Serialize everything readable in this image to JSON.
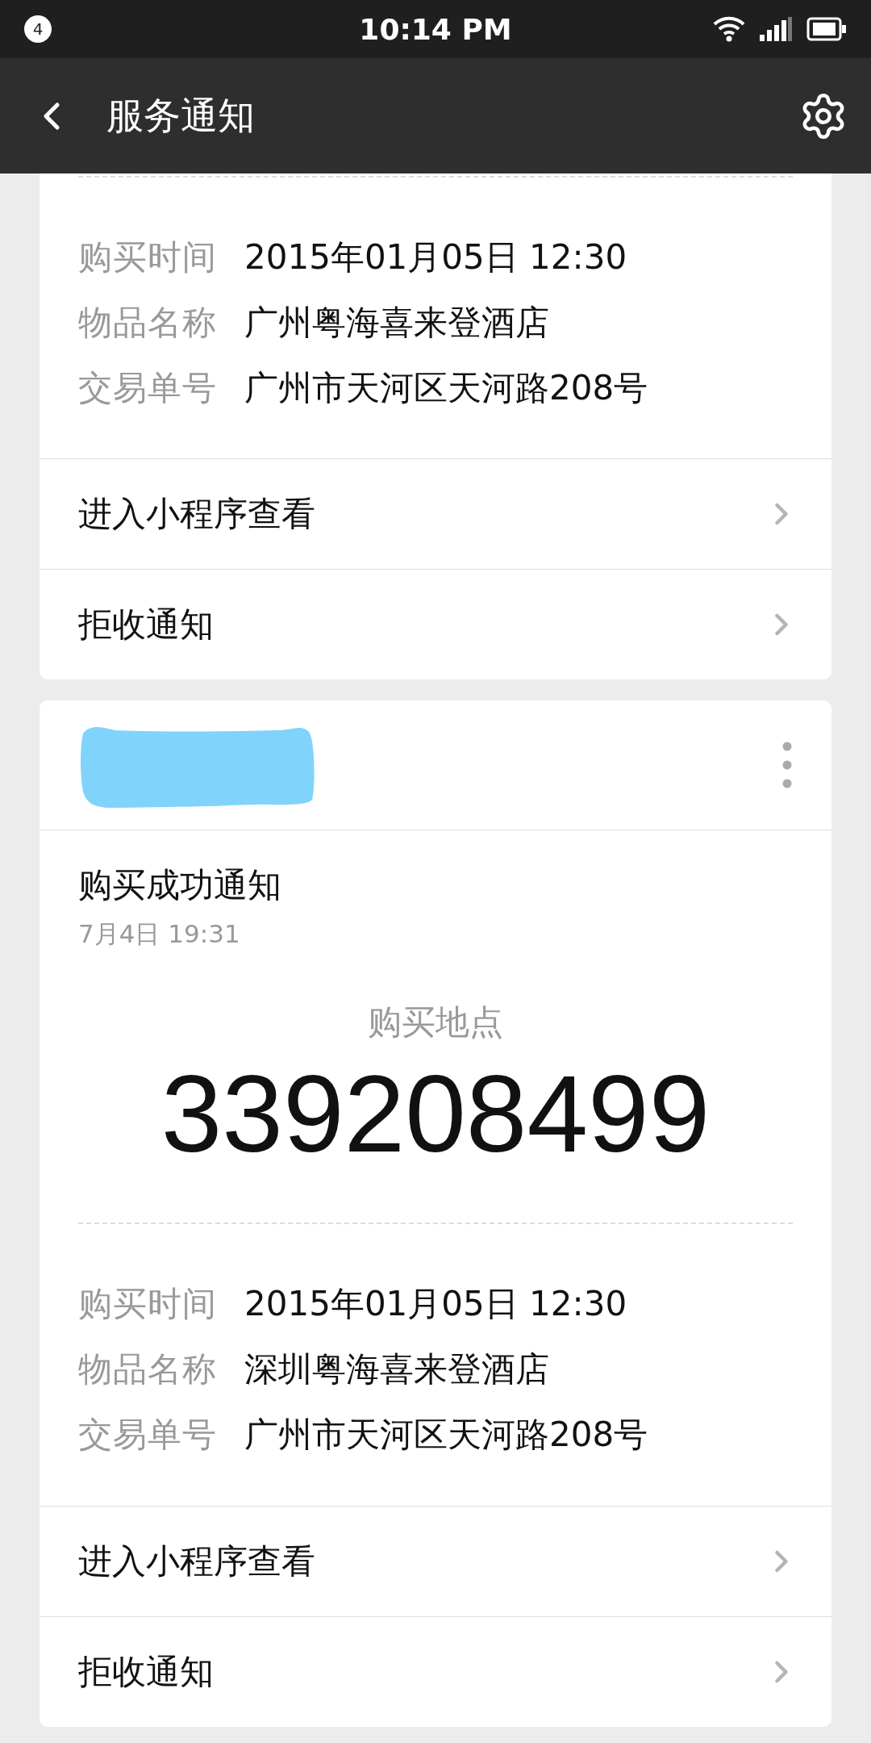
{
  "status_bar": {
    "notification_count": "4",
    "time": "10:14 PM"
  },
  "nav": {
    "title": "服务通知"
  },
  "cards": [
    {
      "details": [
        {
          "label": "购买时间",
          "value": "2015年01月05日 12:30"
        },
        {
          "label": "物品名称",
          "value": "广州粤海喜来登酒店"
        },
        {
          "label": "交易单号",
          "value": "广州市天河区天河路208号"
        }
      ],
      "actions": [
        "进入小程序查看",
        "拒收通知"
      ]
    },
    {
      "sender_redacted": true,
      "title": "购买成功通知",
      "date": "7月4日  19:31",
      "highlight_label": "购买地点",
      "highlight_value": "339208499",
      "details": [
        {
          "label": "购买时间",
          "value": "2015年01月05日 12:30"
        },
        {
          "label": "物品名称",
          "value": "深圳粤海喜来登酒店"
        },
        {
          "label": "交易单号",
          "value": "广州市天河区天河路208号"
        }
      ],
      "actions": [
        "进入小程序查看",
        "拒收通知"
      ]
    }
  ]
}
